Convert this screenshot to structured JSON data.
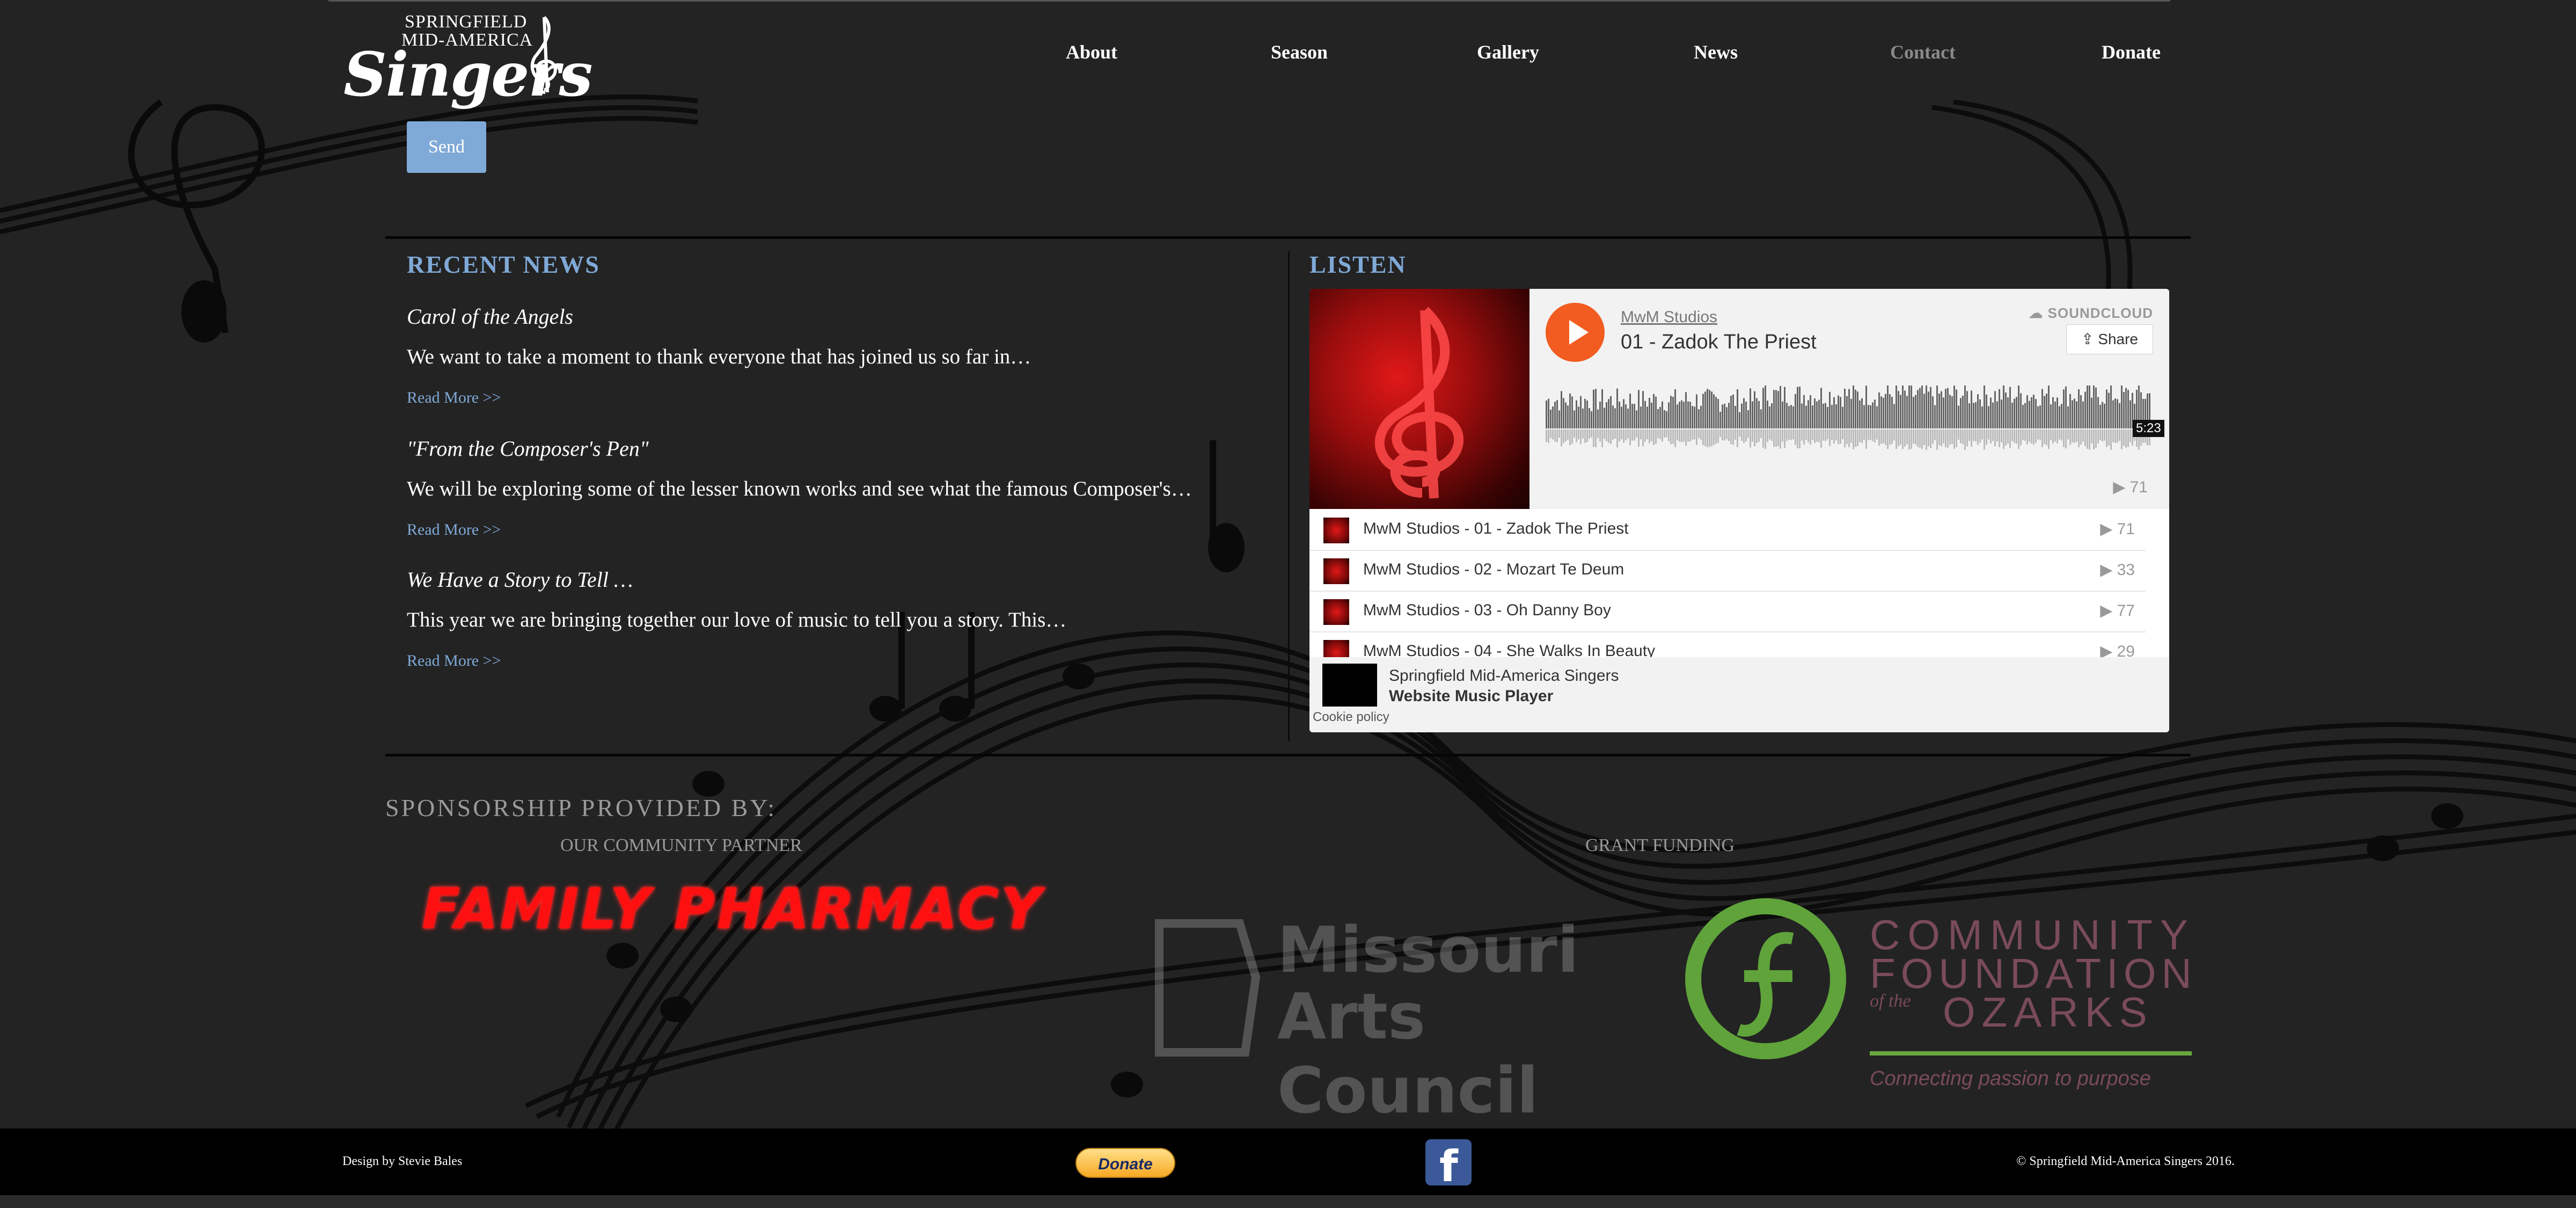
{
  "site": {
    "logo": {
      "line1": "SPRINGFIELD",
      "line2": "MID-AMERICA",
      "line3": "Singers"
    },
    "nav": [
      "About",
      "Season",
      "Gallery",
      "News",
      "Contact",
      "Donate"
    ],
    "active_nav": "Contact"
  },
  "form": {
    "send_label": "Send"
  },
  "news": {
    "heading": "RECENT NEWS",
    "items": [
      {
        "title": "Carol of the Angels",
        "excerpt": "We want to take a moment to thank everyone that has joined us so far in…",
        "link": "Read More >>"
      },
      {
        "title": "\"From the Composer's Pen\"",
        "excerpt": "We will be exploring some of the lesser known works and see what the famous Composer's…",
        "link": "Read More >>"
      },
      {
        "title": "We Have a Story to Tell …",
        "excerpt": "This year we are bringing together our love of music to tell you a story. This…",
        "link": "Read More >>"
      }
    ]
  },
  "listen": {
    "heading": "LISTEN",
    "player": {
      "user": "MwM Studios",
      "track": "01 - Zadok The Priest",
      "brand": "SOUNDCLOUD",
      "share_label": "Share",
      "duration": "5:23",
      "plays": "▶ 71",
      "tracks": [
        {
          "title": "MwM Studios - 01 - Zadok The Priest",
          "plays": "▶ 71"
        },
        {
          "title": "MwM Studios - 02 - Mozart Te Deum",
          "plays": "▶ 33"
        },
        {
          "title": "MwM Studios - 03 - Oh Danny Boy",
          "plays": "▶ 77"
        },
        {
          "title": "MwM Studios - 04 - She Walks In Beauty",
          "plays": "▶ 29"
        }
      ],
      "footer_name": "Springfield Mid-America Singers",
      "footer_sub": "Website Music Player",
      "cookie": "Cookie policy"
    }
  },
  "sponsors": {
    "heading": "SPONSORSHIP PROVIDED BY:",
    "partner_label": "OUR COMMUNITY PARTNER",
    "grant_label": "GRANT FUNDING",
    "partner_logo": "FAMILY PHARMACY",
    "mac_logo": {
      "line1": "Missouri",
      "line2": "Arts Council"
    },
    "cfo_logo": {
      "line1": "COMMUNITY",
      "line2": "FOUNDATION",
      "of_the": "of the",
      "line3": "OZARKS",
      "tagline": "Connecting passion to purpose"
    }
  },
  "footer": {
    "design": "Design by Stevie Bales",
    "donate_label": "Donate",
    "copyright": "© Springfield Mid-America Singers 2016."
  },
  "colors": {
    "accent": "#7fa9d7",
    "background": "#232323",
    "soundcloud": "#f25c20",
    "pharmacy": "#ff1010"
  },
  "icons": [
    "treble-clef-icon",
    "play-icon",
    "soundcloud-icon",
    "share-icon",
    "facebook-icon"
  ]
}
